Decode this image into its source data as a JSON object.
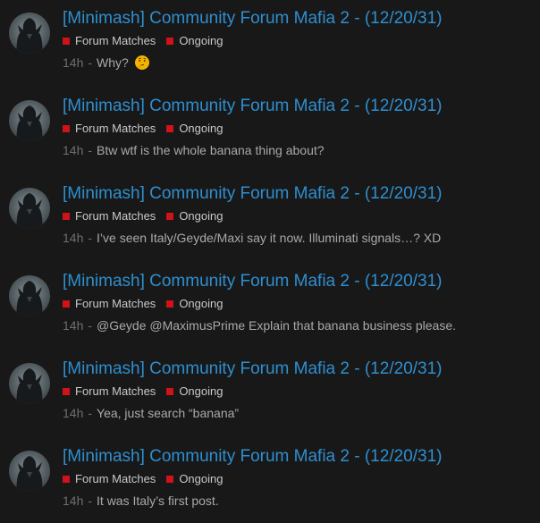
{
  "colors": {
    "background": "#181818",
    "title": "#2e8fd0",
    "tag_square": "#d0121a",
    "timestamp": "#6f6f6f",
    "text": "#a9a9a9"
  },
  "items": [
    {
      "title": "[Minimash] Community Forum Mafia 2 - (12/20/31)",
      "tags": [
        "Forum Matches",
        "Ongoing"
      ],
      "time": "14h",
      "separator": "-",
      "text": "Why?",
      "emoji": "thinking-face-icon"
    },
    {
      "title": "[Minimash] Community Forum Mafia 2 - (12/20/31)",
      "tags": [
        "Forum Matches",
        "Ongoing"
      ],
      "time": "14h",
      "separator": "-",
      "text": "Btw wtf is the whole banana thing about?"
    },
    {
      "title": "[Minimash] Community Forum Mafia 2 - (12/20/31)",
      "tags": [
        "Forum Matches",
        "Ongoing"
      ],
      "time": "14h",
      "separator": "-",
      "text": "I’ve seen Italy/Geyde/Maxi say it now. Illuminati signals…? XD"
    },
    {
      "title": "[Minimash] Community Forum Mafia 2 - (12/20/31)",
      "tags": [
        "Forum Matches",
        "Ongoing"
      ],
      "time": "14h",
      "separator": "-",
      "text": "@Geyde @MaximusPrime Explain that banana business please."
    },
    {
      "title": "[Minimash] Community Forum Mafia 2 - (12/20/31)",
      "tags": [
        "Forum Matches",
        "Ongoing"
      ],
      "time": "14h",
      "separator": "-",
      "text": "Yea, just search “banana”"
    },
    {
      "title": "[Minimash] Community Forum Mafia 2 - (12/20/31)",
      "tags": [
        "Forum Matches",
        "Ongoing"
      ],
      "time": "14h",
      "separator": "-",
      "text": "It was Italy’s first post."
    }
  ]
}
